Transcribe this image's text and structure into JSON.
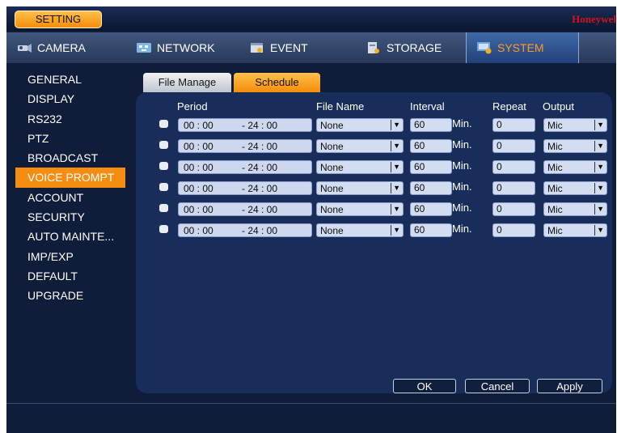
{
  "title": "SETTING",
  "brand": "Honeywel",
  "nav": [
    {
      "label": "CAMERA",
      "icon": "camera-icon"
    },
    {
      "label": "NETWORK",
      "icon": "network-icon"
    },
    {
      "label": "EVENT",
      "icon": "event-icon"
    },
    {
      "label": "STORAGE",
      "icon": "storage-icon"
    },
    {
      "label": "SYSTEM",
      "icon": "system-icon",
      "active": true
    }
  ],
  "sidebar": [
    "GENERAL",
    "DISPLAY",
    "RS232",
    "PTZ",
    "BROADCAST",
    "VOICE PROMPT",
    "ACCOUNT",
    "SECURITY",
    "AUTO MAINTE...",
    "IMP/EXP",
    "DEFAULT",
    "UPGRADE"
  ],
  "sidebar_active": "VOICE PROMPT",
  "subtabs": {
    "file_manage": "File Manage",
    "schedule": "Schedule"
  },
  "headers": {
    "period": "Period",
    "file_name": "File Name",
    "interval": "Interval",
    "repeat": "Repeat",
    "output": "Output"
  },
  "rows": [
    {
      "start": "00 : 00",
      "end": "- 24 : 00",
      "file": "None",
      "interval": "60",
      "unit": "Min.",
      "repeat": "0",
      "output": "Mic"
    },
    {
      "start": "00 : 00",
      "end": "- 24 : 00",
      "file": "None",
      "interval": "60",
      "unit": "Min.",
      "repeat": "0",
      "output": "Mic"
    },
    {
      "start": "00 : 00",
      "end": "- 24 : 00",
      "file": "None",
      "interval": "60",
      "unit": "Min.",
      "repeat": "0",
      "output": "Mic"
    },
    {
      "start": "00 : 00",
      "end": "- 24 : 00",
      "file": "None",
      "interval": "60",
      "unit": "Min.",
      "repeat": "0",
      "output": "Mic"
    },
    {
      "start": "00 : 00",
      "end": "- 24 : 00",
      "file": "None",
      "interval": "60",
      "unit": "Min.",
      "repeat": "0",
      "output": "Mic"
    },
    {
      "start": "00 : 00",
      "end": "- 24 : 00",
      "file": "None",
      "interval": "60",
      "unit": "Min.",
      "repeat": "0",
      "output": "Mic"
    }
  ],
  "buttons": {
    "ok": "OK",
    "cancel": "Cancel",
    "apply": "Apply"
  },
  "colors": {
    "accent": "#f58d0a",
    "panel": "#182d5a",
    "brand": "#d1141c"
  }
}
